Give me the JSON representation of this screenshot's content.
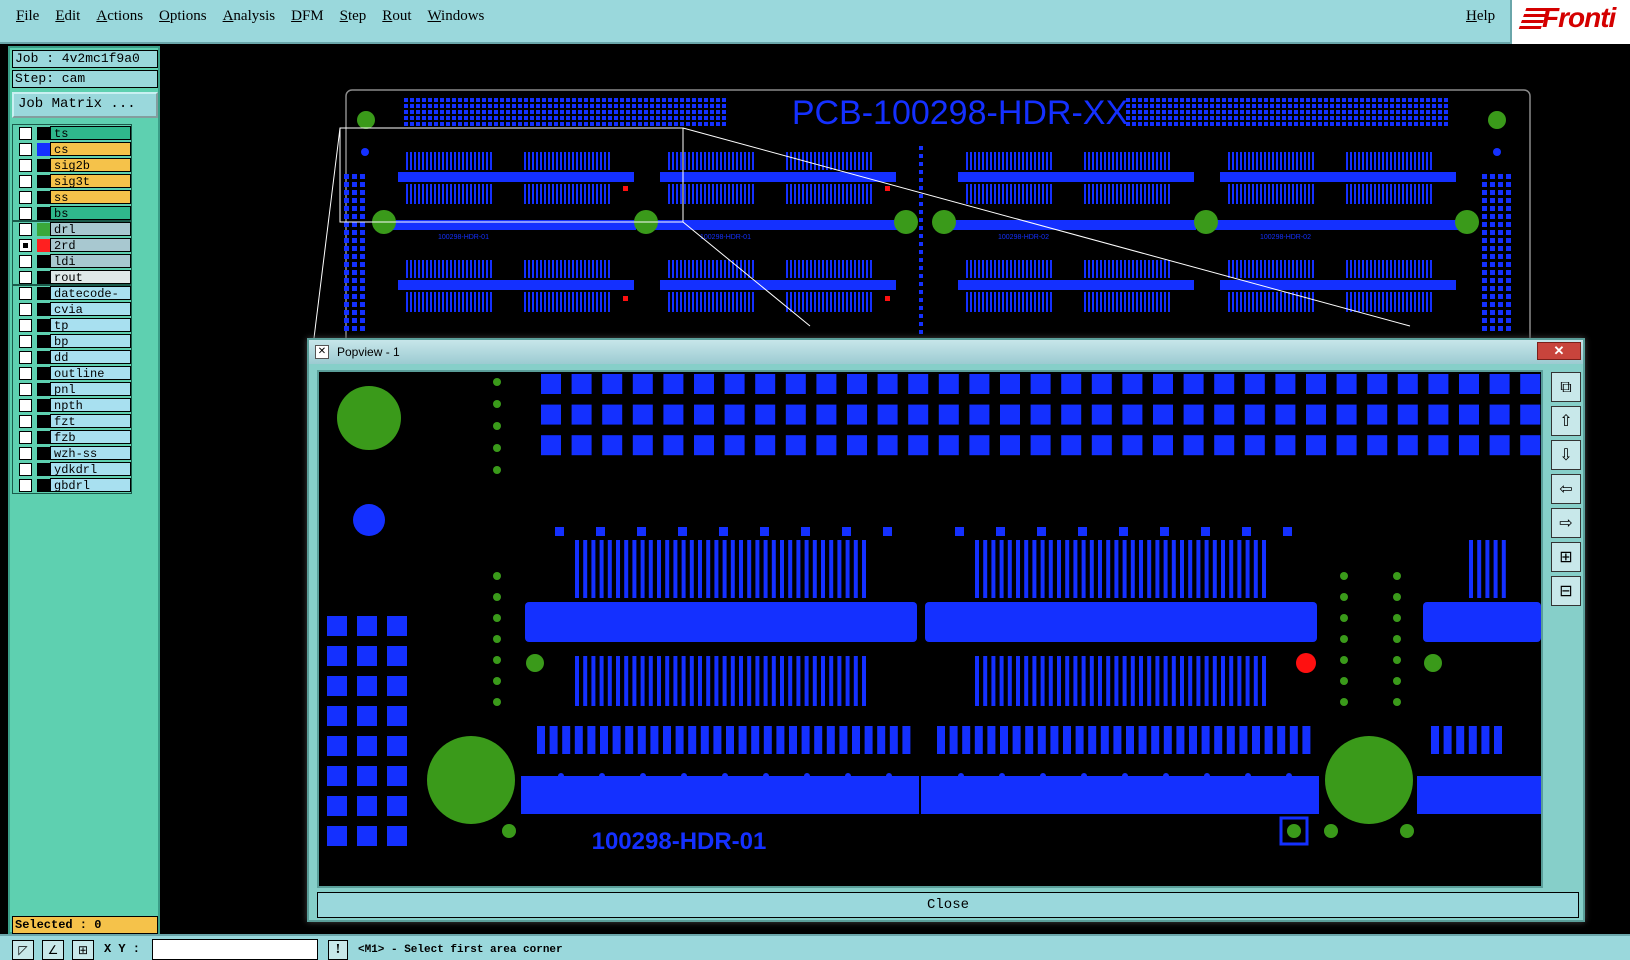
{
  "menu": {
    "items": [
      "File",
      "Edit",
      "Actions",
      "Options",
      "Analysis",
      "DFM",
      "Step",
      "Rout",
      "Windows"
    ],
    "help": "Help"
  },
  "logo": {
    "text": "Fronti"
  },
  "sidebar": {
    "job": "Job : 4v2mc1f9a0",
    "step": "Step: cam",
    "job_matrix": "Job Matrix ...",
    "selected": "Selected : 0",
    "groups": [
      [
        {
          "name": "ts",
          "swatch": "#000000",
          "color": "#2fb88c",
          "checked": false
        },
        {
          "name": "cs",
          "swatch": "#1430ff",
          "color": "#f5c24a",
          "checked": false
        },
        {
          "name": "sig2b",
          "swatch": "#000000",
          "color": "#f5c24a",
          "checked": false
        },
        {
          "name": "sig3t",
          "swatch": "#000000",
          "color": "#f5c24a",
          "checked": false
        },
        {
          "name": "ss",
          "swatch": "#000000",
          "color": "#f5c24a",
          "checked": false
        },
        {
          "name": "bs",
          "swatch": "#000000",
          "color": "#2fb88c",
          "checked": false
        }
      ],
      [
        {
          "name": "drl",
          "swatch": "#3aa83a",
          "color": "#a8c8d0",
          "checked": false
        },
        {
          "name": "2rd",
          "swatch": "#ff2020",
          "color": "#a8c8d0",
          "checked": true
        },
        {
          "name": "ldi",
          "swatch": "#000000",
          "color": "#a8c8d0",
          "checked": false
        },
        {
          "name": "rout",
          "swatch": "#000000",
          "color": "#e0e8e8",
          "checked": false
        }
      ],
      [
        {
          "name": "datecode-ss",
          "swatch": "#000000",
          "color": "#a8e0f0",
          "checked": false
        },
        {
          "name": "cvia",
          "swatch": "#000000",
          "color": "#a8e0f0",
          "checked": false
        },
        {
          "name": "tp",
          "swatch": "#000000",
          "color": "#a8e0f0",
          "checked": false
        },
        {
          "name": "bp",
          "swatch": "#000000",
          "color": "#a8e0f0",
          "checked": false
        },
        {
          "name": "dd",
          "swatch": "#000000",
          "color": "#a8e0f0",
          "checked": false
        },
        {
          "name": "outline",
          "swatch": "#000000",
          "color": "#a8e0f0",
          "checked": false
        },
        {
          "name": "pnl",
          "swatch": "#000000",
          "color": "#a8e0f0",
          "checked": false
        },
        {
          "name": "npth",
          "swatch": "#000000",
          "color": "#a8e0f0",
          "checked": false
        },
        {
          "name": "fzt",
          "swatch": "#000000",
          "color": "#a8e0f0",
          "checked": false
        },
        {
          "name": "fzb",
          "swatch": "#000000",
          "color": "#a8e0f0",
          "checked": false
        },
        {
          "name": "wzh-ss",
          "swatch": "#000000",
          "color": "#a8e0f0",
          "checked": false
        },
        {
          "name": "ydkdrl",
          "swatch": "#000000",
          "color": "#a8e0f0",
          "checked": false
        },
        {
          "name": "gbdrl",
          "swatch": "#000000",
          "color": "#a8e0f0",
          "checked": false
        }
      ]
    ]
  },
  "board": {
    "title": "PCB-100298-HDR-XX",
    "module_labels": [
      "100298-HDR-01",
      "100298-HDR-01",
      "100298-HDR-02",
      "100298-HDR-02"
    ]
  },
  "popup": {
    "title": "Popview - 1",
    "close_x": "✕",
    "close_label": "Close",
    "zoom_label": "100298-HDR-01"
  },
  "status": {
    "xy_label": "X Y :",
    "xy_value": "",
    "prompt": "<M1> - Select first area corner"
  },
  "colors": {
    "copper": "#1430ff",
    "drill": "#3a9a1a",
    "marker": "#ff1010",
    "panel": "#9ad8dc"
  }
}
